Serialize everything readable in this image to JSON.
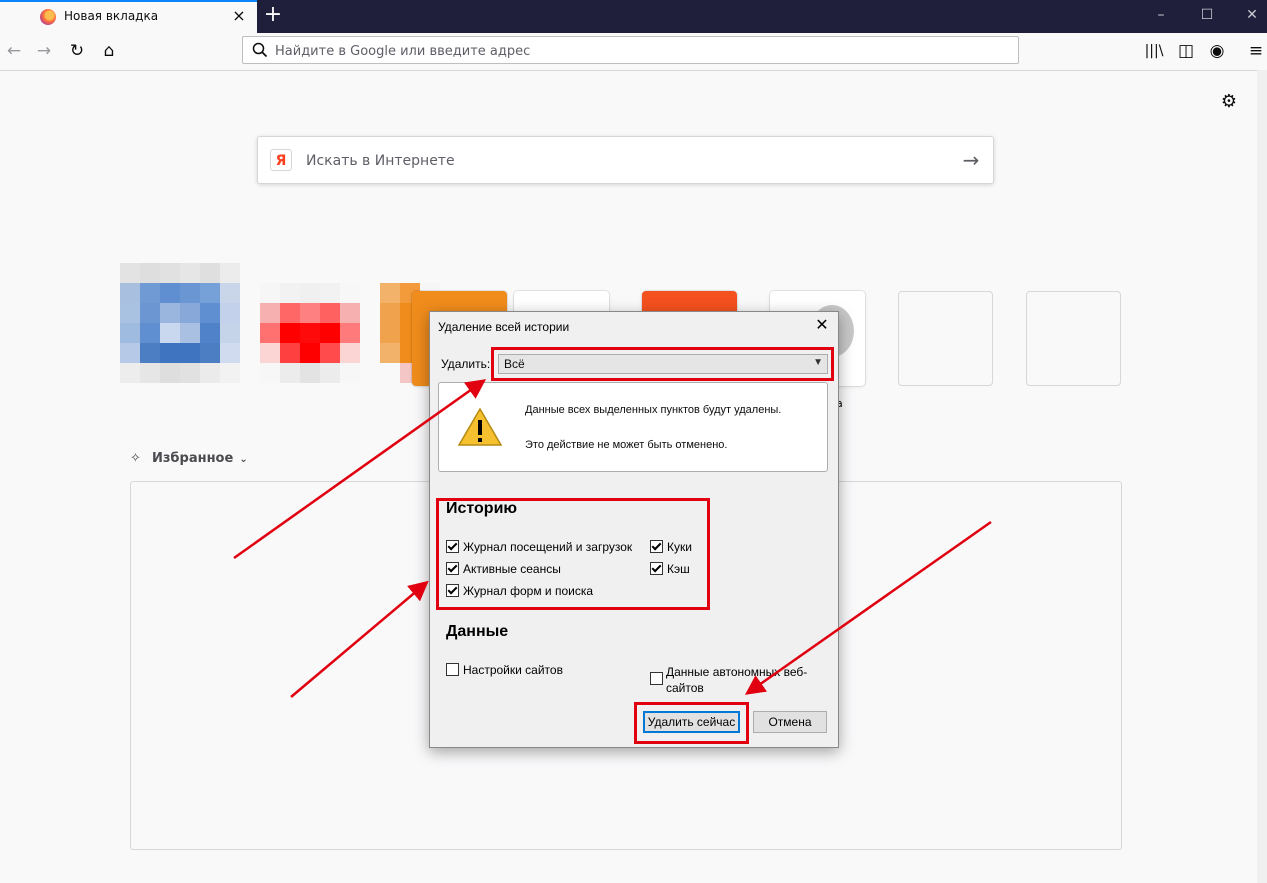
{
  "browser": {
    "tab_title": "Новая вкладка",
    "url_placeholder": "Найдите в Google или введите адрес"
  },
  "newtab": {
    "search_placeholder": "Искать в Интернете",
    "highlights_label": "Избранное",
    "tile_partial_label": "a"
  },
  "dialog": {
    "title": "Удаление всей истории",
    "range_label": "Удалить:",
    "range_value": "Всё",
    "warning_text": "Данные всех выделенных пунктов будут удалены.",
    "warning_subtext": "Это действие не может быть отменено.",
    "history_heading": "Историю",
    "history_items": [
      {
        "label": "Журнал посещений и загрузок",
        "checked": true
      },
      {
        "label": "Активные сеансы",
        "checked": true
      },
      {
        "label": "Журнал форм и поиска",
        "checked": true
      },
      {
        "label": "Куки",
        "checked": true
      },
      {
        "label": "Кэш",
        "checked": true
      }
    ],
    "data_heading": "Данные",
    "data_items": [
      {
        "label": "Настройки сайтов",
        "checked": false
      },
      {
        "label": "Данные автономных веб-сайтов",
        "checked": false
      }
    ],
    "ok_button": "Удалить сейчас",
    "cancel_button": "Отмена"
  },
  "colors": {
    "highlight": "#e0000f",
    "tabbar": "#1f1f3b",
    "accent": "#0a84ff"
  }
}
